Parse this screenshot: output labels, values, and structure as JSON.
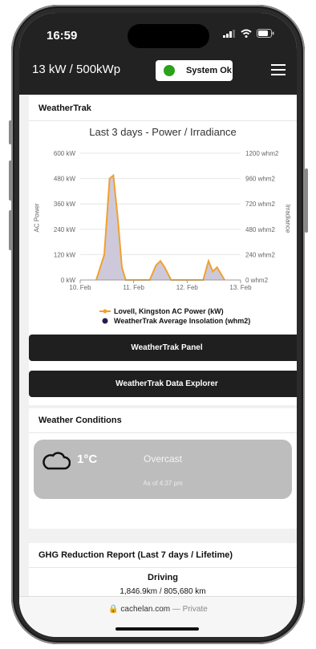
{
  "status_bar": {
    "time": "16:59"
  },
  "header": {
    "title": "13 kW / 500kWp",
    "system_status": "System Ok"
  },
  "weathertrak": {
    "title": "WeatherTrak",
    "panel_button": "WeatherTrak Panel",
    "explorer_button": "WeatherTrak Data Explorer"
  },
  "chart_data": {
    "type": "area",
    "title": "Last 3 days - Power / Irradiance",
    "x_ticks": [
      "10. Feb",
      "11. Feb",
      "12. Feb",
      "13. Feb"
    ],
    "y_left_ticks": [
      "600 kW",
      "480 kW",
      "360 kW",
      "240 kW",
      "120 kW",
      "0 kW"
    ],
    "y_right_ticks": [
      "1200 whm2",
      "960 whm2",
      "720 whm2",
      "480 whm2",
      "240 whm2",
      "0 whm2"
    ],
    "ylabel_left": "AC Power",
    "ylabel_right": "Irradiance",
    "ylim_left": [
      0,
      600
    ],
    "ylim_right": [
      0,
      1200
    ],
    "series": [
      {
        "name": "Lovell, Kingston AC Power (kW)",
        "color": "#f0a030",
        "x": [
          10.3,
          10.45,
          10.55,
          10.62,
          10.7,
          10.78,
          10.85,
          11.3,
          11.42,
          11.5,
          11.58,
          11.7,
          12.3,
          12.4,
          12.48,
          12.56,
          12.7
        ],
        "y": [
          0,
          120,
          480,
          495,
          300,
          60,
          0,
          0,
          70,
          90,
          60,
          0,
          0,
          90,
          40,
          60,
          0
        ]
      },
      {
        "name": "WeatherTrak Average Insolation (whm2)",
        "color": "#2a1a4a",
        "x": [
          10.3,
          10.45,
          10.55,
          10.62,
          10.7,
          10.78,
          10.85,
          11.3,
          11.42,
          11.5,
          11.58,
          11.7,
          12.3,
          12.4,
          12.48,
          12.56,
          12.7
        ],
        "y": [
          0,
          240,
          960,
          990,
          600,
          120,
          0,
          0,
          140,
          180,
          120,
          0,
          0,
          180,
          80,
          120,
          0
        ]
      }
    ],
    "legend": [
      "Lovell, Kingston AC Power (kW)",
      "WeatherTrak Average Insolation (whm2)"
    ]
  },
  "weather": {
    "title": "Weather Conditions",
    "temperature": "1°C",
    "condition": "Overcast",
    "as_of": "As of 4:37 pm",
    "icon": "cloud-icon"
  },
  "ghg": {
    "title": "GHG Reduction Report (Last 7 days / Lifetime)",
    "category": "Driving",
    "value": "1,846.9km / 805,680 km"
  },
  "browser": {
    "domain": "cachelan.com",
    "mode": "— Private"
  }
}
